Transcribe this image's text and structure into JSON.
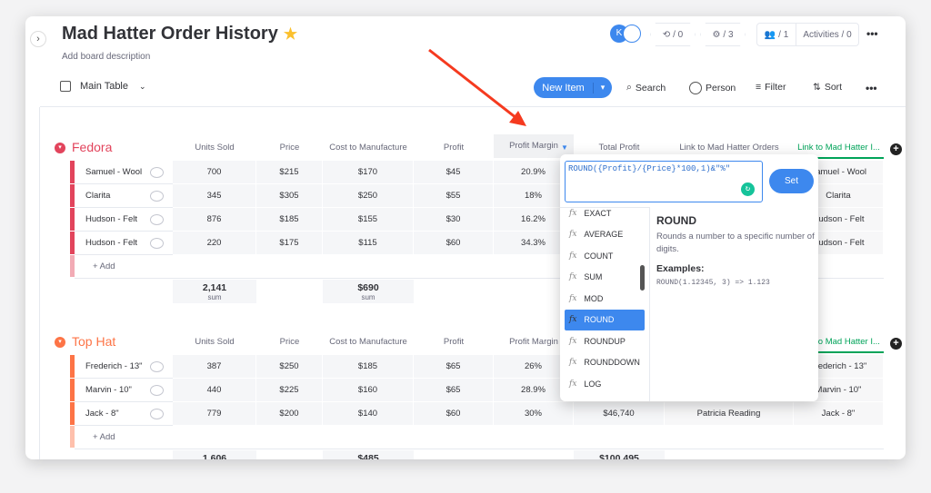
{
  "board": {
    "title": "Mad Hatter Order History",
    "description": "Add board description",
    "view": "Main Table"
  },
  "header": {
    "avatar_initial": "K",
    "integrations": "/ 0",
    "automations": "/ 3",
    "members": "/ 1",
    "activities": "Activities / 0",
    "more": "•••"
  },
  "toolbar": {
    "new_item": "New Item",
    "search": "Search",
    "person": "Person",
    "filter": "Filter",
    "sort": "Sort",
    "more": "•••"
  },
  "columns": [
    "Units Sold",
    "Price",
    "Cost to Manufacture",
    "Profit",
    "Profit Margin",
    "Total Profit",
    "Link to Mad Hatter Orders",
    "Link to Mad Hatter I..."
  ],
  "groups": [
    {
      "name": "Fedora",
      "color": "#e2445c",
      "rows": [
        {
          "name": "Samuel - Wool",
          "units": "700",
          "price": "$215",
          "cost": "$170",
          "profit": "$45",
          "margin": "20.9%",
          "link2": "Samuel - Wool"
        },
        {
          "name": "Clarita",
          "units": "345",
          "price": "$305",
          "cost": "$250",
          "profit": "$55",
          "margin": "18%",
          "link2": "Clarita"
        },
        {
          "name": "Hudson - Felt",
          "units": "876",
          "price": "$185",
          "cost": "$155",
          "profit": "$30",
          "margin": "16.2%",
          "link2": "Hudson - Felt"
        },
        {
          "name": "Hudson - Felt",
          "units": "220",
          "price": "$175",
          "cost": "$115",
          "profit": "$60",
          "margin": "34.3%",
          "link2": "Hudson - Felt"
        }
      ],
      "add": "+ Add",
      "sum_units": "2,141",
      "sum_cost": "$690",
      "sum_label": "sum"
    },
    {
      "name": "Top Hat",
      "color": "#fd7446",
      "rows": [
        {
          "name": "Frederich - 13\"",
          "units": "387",
          "price": "$250",
          "cost": "$185",
          "profit": "$65",
          "margin": "26%",
          "link2": "Frederich - 13\""
        },
        {
          "name": "Marvin - 10\"",
          "units": "440",
          "price": "$225",
          "cost": "$160",
          "profit": "$65",
          "margin": "28.9%",
          "link2": "Marvin - 10\""
        },
        {
          "name": "Jack - 8\"",
          "units": "779",
          "price": "$200",
          "cost": "$140",
          "profit": "$60",
          "margin": "30%",
          "total": "$46,740",
          "link1": "Patricia Reading",
          "link2": "Jack - 8\""
        }
      ],
      "add": "+ Add",
      "sum_units": "1,606",
      "sum_cost": "$485",
      "sum_total": "$100,495"
    }
  ],
  "formula": {
    "value": "ROUND({Profit}/{Price}*100,1)&\"%\"",
    "set": "Set",
    "functions": [
      "EXACT",
      "AVERAGE",
      "COUNT",
      "SUM",
      "MOD",
      "ROUND",
      "ROUNDUP",
      "ROUNDDOWN",
      "LOG"
    ],
    "selected": "ROUND",
    "detail_title": "ROUND",
    "detail_desc": "Rounds a number to a specific number of digits.",
    "examples_label": "Examples:",
    "example": "ROUND(1.12345, 3) => 1.123"
  },
  "colors": {
    "accent": "#3d88ee",
    "fedora": "#e2445c",
    "tophat": "#fd7446",
    "annotation_arrow": "#f53a1f"
  }
}
